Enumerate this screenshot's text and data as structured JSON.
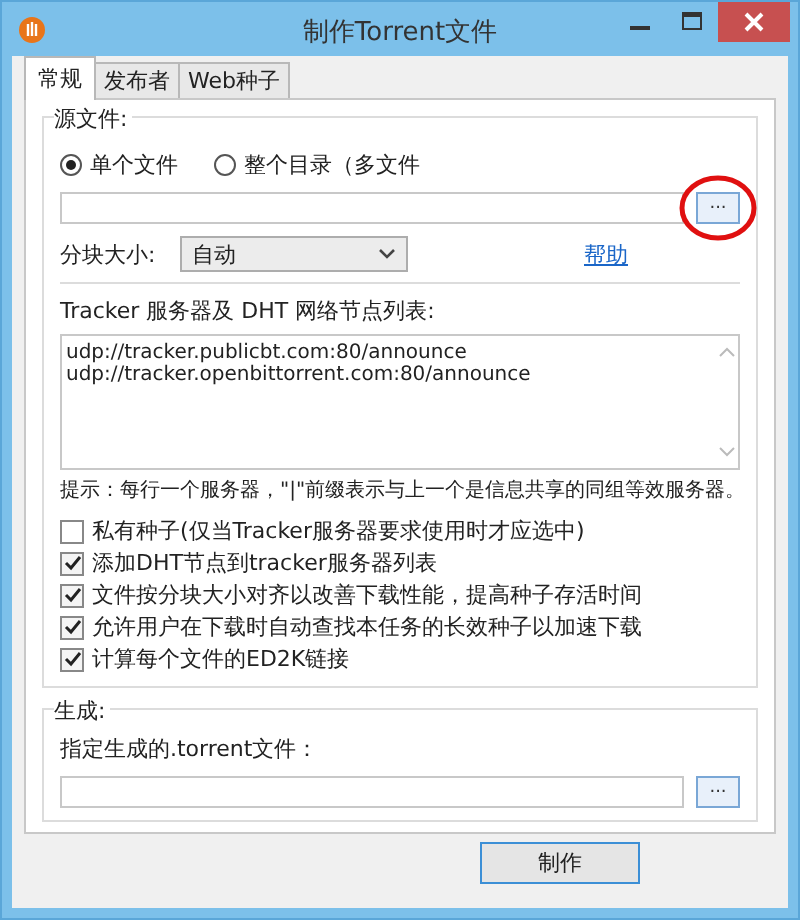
{
  "window": {
    "title": "制作Torrent文件"
  },
  "tabs": [
    {
      "label": "常规",
      "selected": true
    },
    {
      "label": "发布者",
      "selected": false
    },
    {
      "label": "Web种子",
      "selected": false
    }
  ],
  "source": {
    "title": "源文件:",
    "modes": [
      {
        "label": "单个文件",
        "selected": true
      },
      {
        "label": "整个目录（多文件",
        "selected": false
      }
    ],
    "browse_button": "...",
    "piece_size": {
      "label": "分块大小:",
      "value": "自动"
    },
    "help_link": "帮助"
  },
  "trackers": {
    "label": "Tracker 服务器及 DHT 网络节点列表:",
    "lines": [
      "udp://tracker.publicbt.com:80/announce",
      "udp://tracker.openbittorrent.com:80/announce"
    ],
    "hint": "提示：每行一个服务器，\"|\"前缀表示与上一个是信息共享的同组等效服务器。"
  },
  "options": [
    {
      "label": "私有种子(仅当Tracker服务器要求使用时才应选中)",
      "checked": false
    },
    {
      "label": "添加DHT节点到tracker服务器列表",
      "checked": true
    },
    {
      "label": "文件按分块大小对齐以改善下载性能，提高种子存活时间",
      "checked": true
    },
    {
      "label": "允许用户在下载时自动查找本任务的长效种子以加速下载",
      "checked": true
    },
    {
      "label": "计算每个文件的ED2K链接",
      "checked": true
    }
  ],
  "output": {
    "title": "生成:",
    "label": "指定生成的.torrent文件：",
    "browse_button": "..."
  },
  "create_button": "制作"
}
